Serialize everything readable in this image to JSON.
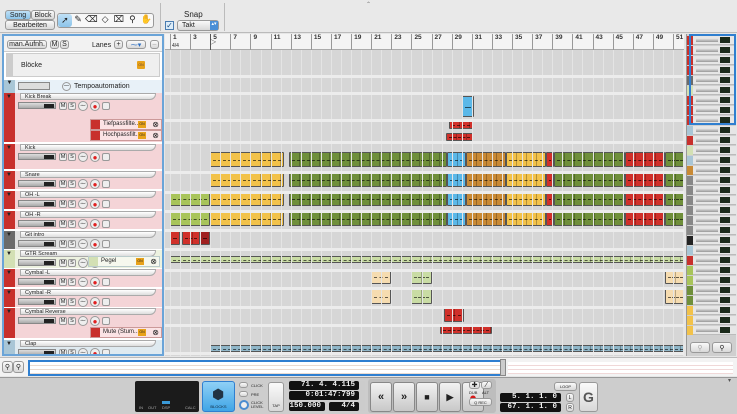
{
  "toolbar": {
    "mode_song": "Song",
    "mode_block": "Block",
    "edit_button": "Bearbeiten",
    "tools": [
      "select-arrow",
      "pencil",
      "eraser",
      "razor",
      "mute-tool",
      "magnify",
      "hand"
    ],
    "snap_label": "Snap",
    "snap_enabled": true,
    "snap_value": "Takt"
  },
  "tracklist_header": {
    "record_mode": "man.Aufnh.",
    "mute": "M",
    "solo": "S",
    "lanes_label": "Lanes",
    "add": "+",
    "lanes_dropdown": "",
    "blocks_label": "Blöcke",
    "blocks_badge": "ON",
    "tempo_label": "Tempoautomation"
  },
  "tracks": [
    {
      "name": "Kick Break",
      "key": "kickbreak",
      "color": "#c8302c",
      "bg": "#f4d4d7",
      "automation": [
        {
          "name": "Tiefpassfilte...",
          "badge": "ON"
        },
        {
          "name": "Hochpassfilt...",
          "badge": "ON"
        }
      ]
    },
    {
      "name": "Kick",
      "key": "kick",
      "color": "#c8302c",
      "bg": "#f4d4d7"
    },
    {
      "name": "Snare",
      "key": "snare",
      "color": "#c8302c",
      "bg": "#f4d4d7"
    },
    {
      "name": "OH -L",
      "key": "ohl",
      "color": "#c8302c",
      "bg": "#f4d4d7"
    },
    {
      "name": "OH -R",
      "key": "ohr",
      "color": "#c8302c",
      "bg": "#f4d4d7"
    },
    {
      "name": "Git intro",
      "key": "git",
      "color": "#6b6b6b",
      "bg": "#e2e2e2"
    },
    {
      "name": "GTR Scream",
      "key": "gtr",
      "color": "#d3e0b4",
      "bg": "#edf2e0",
      "automation": [
        {
          "name": "Pegel",
          "badge": "ON"
        }
      ]
    },
    {
      "name": "Cymbal -L",
      "key": "cyml",
      "color": "#c8302c",
      "bg": "#f4d4d7"
    },
    {
      "name": "Cymbal -R",
      "key": "cymr",
      "color": "#c8302c",
      "bg": "#f4d4d7"
    },
    {
      "name": "Cymbal Reverse",
      "key": "cymrev",
      "color": "#c8302c",
      "bg": "#f4d4d7",
      "automation": [
        {
          "name": "Mute (Stum...",
          "badge": "ON"
        }
      ]
    },
    {
      "name": "Clap",
      "key": "clap",
      "color": "#a9c6d6",
      "bg": "#dfeaf0"
    }
  ],
  "track_buttons": {
    "mute": "M",
    "solo": "S"
  },
  "ruler": {
    "time_signature": "4/4",
    "bars": [
      "1",
      "3",
      "5",
      "7",
      "9",
      "11",
      "13",
      "15",
      "17",
      "19",
      "21",
      "23",
      "25",
      "27",
      "29",
      "31",
      "33",
      "35",
      "37",
      "39",
      "41",
      "43",
      "45",
      "47",
      "49",
      "51"
    ]
  },
  "clips": [
    {
      "lane": "kickbreak",
      "start": 30,
      "end": 31.2,
      "color": "#5bb8e8"
    },
    {
      "lane": "tief",
      "start": 28.7,
      "end": 31.1,
      "color": "#d0302a"
    },
    {
      "lane": "hoch",
      "start": 28.4,
      "end": 31.1,
      "color": "#d0302a"
    },
    {
      "lane": "kick",
      "start": 5,
      "end": 12.3,
      "color": "#f2c24a"
    },
    {
      "lane": "kick",
      "start": 12.8,
      "end": 28.5,
      "color": "#6f8f3a"
    },
    {
      "lane": "kick",
      "start": 28.5,
      "end": 30.4,
      "color": "#5bb8e8"
    },
    {
      "lane": "kick",
      "start": 30.4,
      "end": 34.4,
      "color": "#c98a35"
    },
    {
      "lane": "kick",
      "start": 34.4,
      "end": 38.4,
      "color": "#f2c24a"
    },
    {
      "lane": "kick",
      "start": 38.4,
      "end": 39.2,
      "color": "#d0302a"
    },
    {
      "lane": "kick",
      "start": 39.2,
      "end": 46.2,
      "color": "#6f8f3a"
    },
    {
      "lane": "kick",
      "start": 46.2,
      "end": 50.2,
      "color": "#d0302a"
    },
    {
      "lane": "kick",
      "start": 50.2,
      "end": 52.3,
      "color": "#6f8f3a"
    },
    {
      "lane": "snare",
      "start": 5,
      "end": 12.3,
      "color": "#f2c24a"
    },
    {
      "lane": "snare",
      "start": 12.8,
      "end": 28.5,
      "color": "#6f8f3a"
    },
    {
      "lane": "snare",
      "start": 28.5,
      "end": 30.4,
      "color": "#5bb8e8"
    },
    {
      "lane": "snare",
      "start": 30.4,
      "end": 34.4,
      "color": "#c98a35"
    },
    {
      "lane": "snare",
      "start": 34.4,
      "end": 38.4,
      "color": "#f2c24a"
    },
    {
      "lane": "snare",
      "start": 38.4,
      "end": 39.2,
      "color": "#d0302a"
    },
    {
      "lane": "snare",
      "start": 39.2,
      "end": 46.2,
      "color": "#6f8f3a"
    },
    {
      "lane": "snare",
      "start": 46.2,
      "end": 50.2,
      "color": "#d0302a"
    },
    {
      "lane": "snare",
      "start": 50.2,
      "end": 52.3,
      "color": "#6f8f3a"
    },
    {
      "lane": "ohl",
      "start": 1,
      "end": 5,
      "color": "#a8c45a"
    },
    {
      "lane": "ohl",
      "start": 5,
      "end": 12.3,
      "color": "#f2c24a"
    },
    {
      "lane": "ohl",
      "start": 12.8,
      "end": 28.5,
      "color": "#6f8f3a"
    },
    {
      "lane": "ohl",
      "start": 28.5,
      "end": 30.4,
      "color": "#5bb8e8"
    },
    {
      "lane": "ohl",
      "start": 30.4,
      "end": 34.4,
      "color": "#c98a35"
    },
    {
      "lane": "ohl",
      "start": 34.4,
      "end": 38.4,
      "color": "#f2c24a"
    },
    {
      "lane": "ohl",
      "start": 38.4,
      "end": 39.2,
      "color": "#d0302a"
    },
    {
      "lane": "ohl",
      "start": 39.2,
      "end": 46.2,
      "color": "#6f8f3a"
    },
    {
      "lane": "ohl",
      "start": 46.2,
      "end": 50.2,
      "color": "#d0302a"
    },
    {
      "lane": "ohl",
      "start": 50.2,
      "end": 52.3,
      "color": "#6f8f3a"
    },
    {
      "lane": "ohr",
      "start": 1,
      "end": 5,
      "color": "#a8c45a"
    },
    {
      "lane": "ohr",
      "start": 5,
      "end": 12.3,
      "color": "#f2c24a"
    },
    {
      "lane": "ohr",
      "start": 12.8,
      "end": 28.5,
      "color": "#6f8f3a"
    },
    {
      "lane": "ohr",
      "start": 28.5,
      "end": 30.4,
      "color": "#5bb8e8"
    },
    {
      "lane": "ohr",
      "start": 30.4,
      "end": 34.4,
      "color": "#c98a35"
    },
    {
      "lane": "ohr",
      "start": 34.4,
      "end": 38.4,
      "color": "#f2c24a"
    },
    {
      "lane": "ohr",
      "start": 38.4,
      "end": 39.2,
      "color": "#d0302a"
    },
    {
      "lane": "ohr",
      "start": 39.2,
      "end": 46.2,
      "color": "#6f8f3a"
    },
    {
      "lane": "ohr",
      "start": 46.2,
      "end": 50.2,
      "color": "#d0302a"
    },
    {
      "lane": "ohr",
      "start": 50.2,
      "end": 52.3,
      "color": "#6f8f3a"
    },
    {
      "lane": "git",
      "start": 1,
      "end": 2,
      "color": "#d0302a"
    },
    {
      "lane": "git",
      "start": 2.2,
      "end": 4,
      "color": "#d0302a"
    },
    {
      "lane": "git",
      "start": 4,
      "end": 5,
      "color": "#a02020"
    },
    {
      "lane": "gtr",
      "start": 1,
      "end": 52.3,
      "color": "#c9dca4"
    },
    {
      "lane": "cyml",
      "start": 21,
      "end": 23,
      "color": "#f6dcb0"
    },
    {
      "lane": "cyml",
      "start": 25,
      "end": 27,
      "color": "#c9dca4"
    },
    {
      "lane": "cyml",
      "start": 50.2,
      "end": 52.3,
      "color": "#f6dcb0"
    },
    {
      "lane": "cymr",
      "start": 21,
      "end": 23,
      "color": "#f6dcb0"
    },
    {
      "lane": "cymr",
      "start": 25,
      "end": 27,
      "color": "#c9dca4"
    },
    {
      "lane": "cymr",
      "start": 50.2,
      "end": 52.3,
      "color": "#f6dcb0"
    },
    {
      "lane": "cymrev",
      "start": 28.2,
      "end": 30.2,
      "color": "#d0302a"
    },
    {
      "lane": "mute",
      "start": 27.8,
      "end": 33,
      "color": "#d0302a"
    },
    {
      "lane": "clap",
      "start": 5,
      "end": 52.3,
      "color": "#8fb6c8"
    }
  ],
  "transport": {
    "in_label": "IN",
    "out_label": "OUT",
    "dsp_label": "DSP",
    "calc_label": "CALC",
    "blocks_label": "BLOCKS",
    "click_label": "CLICK",
    "pre_label": "PRE",
    "click_level_label": "CLICK LEVEL",
    "tap_label": "TAP",
    "position": "71. 4. 4.115",
    "time": "0:01:47:799",
    "tempo": "150.000",
    "signature": "4/4",
    "dub_label": "DUB",
    "alt_label": "ALT",
    "qrec_label": "Q REC",
    "loop_label": "LOOP",
    "left_locator": "5. 1. 1.   0",
    "right_locator": "67. 1. 1.   0",
    "l_label": "L",
    "r_label": "R"
  }
}
